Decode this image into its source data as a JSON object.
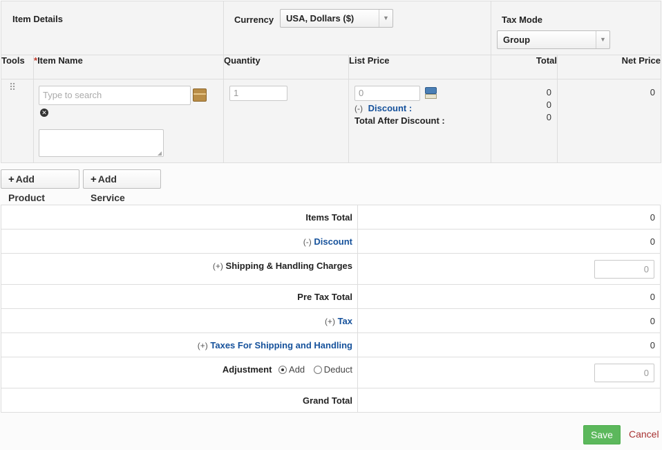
{
  "header": {
    "item_details": "Item Details",
    "currency_label": "Currency",
    "currency_value": "USA, Dollars ($)",
    "tax_mode_label": "Tax Mode",
    "tax_mode_value": "Group"
  },
  "columns": {
    "tools": "Tools",
    "required_mark": "*",
    "item_name": "Item Name",
    "quantity": "Quantity",
    "list_price": "List Price",
    "total": "Total",
    "net_price": "Net Price"
  },
  "line_item": {
    "search_placeholder": "Type to search",
    "quantity": "1",
    "list_price": "0",
    "discount_prefix": "(-)",
    "discount_label": "Discount :",
    "total_after_discount_label": "Total After Discount :",
    "total_values": [
      "0",
      "0",
      "0"
    ],
    "net_price": "0"
  },
  "buttons": {
    "add_product": "Add Product",
    "add_service": "Add Service",
    "plus": "+",
    "save": "Save",
    "cancel": "Cancel"
  },
  "totals": {
    "items_total_label": "Items Total",
    "items_total": "0",
    "discount_prefix": "(-)",
    "discount_label": "Discount",
    "discount": "0",
    "shipping_prefix": "(+)",
    "shipping_label": "Shipping & Handling Charges",
    "shipping": "0",
    "pre_tax_total_label": "Pre Tax Total",
    "pre_tax_total": "0",
    "tax_prefix": "(+)",
    "tax_label": "Tax",
    "tax": "0",
    "shipping_tax_prefix": "(+)",
    "shipping_tax_label": "Taxes For Shipping and Handling",
    "shipping_tax": "0",
    "adjustment_label": "Adjustment",
    "adjustment_add": "Add",
    "adjustment_deduct": "Deduct",
    "adjustment": "0",
    "grand_total_label": "Grand Total"
  },
  "colors": {
    "link": "#15519b",
    "save_button": "#5cb85c",
    "cancel": "#a83232",
    "required": "#c0392b"
  }
}
